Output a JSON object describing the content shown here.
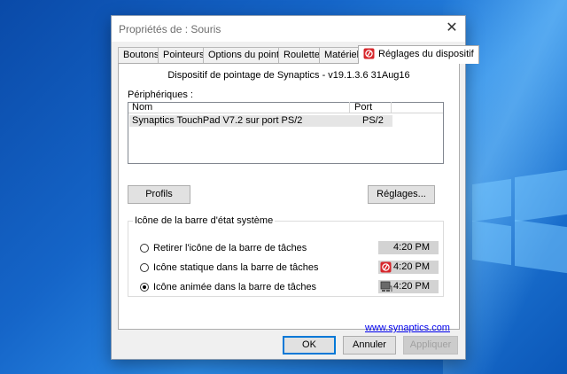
{
  "window": {
    "title": "Propriétés de : Souris",
    "close_glyph": "✕"
  },
  "tabs": [
    {
      "label": "Boutons"
    },
    {
      "label": "Pointeurs"
    },
    {
      "label": "Options du pointeur"
    },
    {
      "label": "Roulette"
    },
    {
      "label": "Matériel"
    },
    {
      "label": "Réglages du dispositif",
      "active": true
    }
  ],
  "device_text": "Dispositif de pointage de Synaptics - v19.1.3.6 31Aug16",
  "peripherals": {
    "label": "Périphériques :",
    "columns": [
      "Nom",
      "Port"
    ],
    "rows": [
      {
        "name": "Synaptics TouchPad V7.2 sur port PS/2",
        "port": "PS/2",
        "selected": true
      }
    ]
  },
  "buttons": {
    "profils": "Profils",
    "reglages": "Réglages..."
  },
  "tray_group": {
    "legend": "Icône de la barre d'état système",
    "options": [
      {
        "label": "Retirer l'icône de la barre de tâches",
        "checked": false,
        "time": "4:20 PM",
        "icon": "none"
      },
      {
        "label": "Icône statique dans la barre de tâches",
        "checked": false,
        "time": "4:20 PM",
        "icon": "synaptics-icon"
      },
      {
        "label": "Icône animée dans la barre de tâches",
        "checked": true,
        "time": "4:20 PM",
        "icon": "touchpad-animated-icon"
      }
    ]
  },
  "link": "www.synaptics.com",
  "footer": {
    "ok": "OK",
    "cancel": "Annuler",
    "apply": "Appliquer"
  },
  "colors": {
    "synaptics_red": "#d7262b",
    "link": "#0000ee",
    "focus_blue": "#0078d7"
  }
}
